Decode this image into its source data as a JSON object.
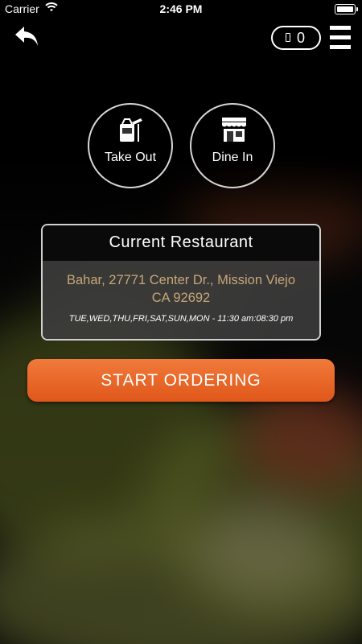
{
  "status_bar": {
    "carrier": "Carrier",
    "time": "2:46 PM"
  },
  "header": {
    "cart_count": "0",
    "icons": [
      "back-arrow-icon",
      "cart-icon",
      "hamburger-menu-icon"
    ]
  },
  "order_types": [
    {
      "label": "Take Out",
      "icon": "takeout-bag-icon"
    },
    {
      "label": "Dine In",
      "icon": "storefront-icon"
    }
  ],
  "restaurant": {
    "title": "Current Restaurant",
    "address_line1": "Bahar, 27771 Center Dr., Mission Viejo",
    "address_line2": "CA 92692",
    "hours": "TUE,WED,THU,FRI,SAT,SUN,MON - 11:30 am:08:30 pm"
  },
  "start_button": {
    "label": "START ORDERING"
  },
  "colors": {
    "accent": "#E8662A",
    "address": "#C8A677"
  }
}
